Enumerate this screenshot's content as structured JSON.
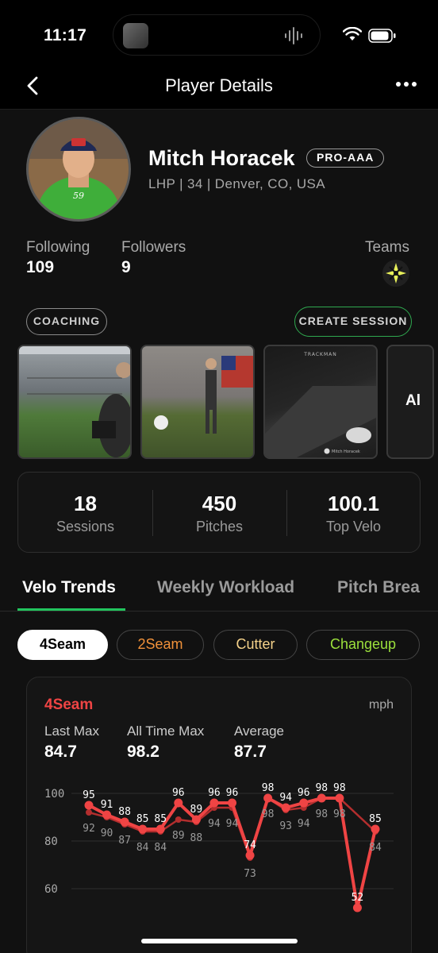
{
  "status_bar": {
    "time": "11:17"
  },
  "nav": {
    "title": "Player Details"
  },
  "profile": {
    "name": "Mitch Horacek",
    "level": "PRO-AAA",
    "meta": "LHP | 34 | Denver, CO, USA"
  },
  "social": {
    "following_label": "Following",
    "following_value": "109",
    "followers_label": "Followers",
    "followers_value": "9",
    "teams_label": "Teams"
  },
  "actions": {
    "coaching": "COACHING",
    "create_session": "CREATE SESSION"
  },
  "media": {
    "third_caption": "TRACKMAN",
    "third_user": "Mitch Horacek",
    "fourth_text": "Al"
  },
  "summary": [
    {
      "value": "18",
      "label": "Sessions"
    },
    {
      "value": "450",
      "label": "Pitches"
    },
    {
      "value": "100.1",
      "label": "Top Velo"
    }
  ],
  "tabs": [
    "Velo Trends",
    "Weekly Workload",
    "Pitch Brea"
  ],
  "pitch_types": [
    {
      "label": "4Seam",
      "color": "#000000"
    },
    {
      "label": "2Seam",
      "color": "#f0913a"
    },
    {
      "label": "Cutter",
      "color": "#f5d28a"
    },
    {
      "label": "Changeup",
      "color": "#9be03c"
    }
  ],
  "card": {
    "title": "4Seam",
    "unit": "mph",
    "metrics": [
      {
        "label": "Last Max",
        "value": "84.7"
      },
      {
        "label": "All Time Max",
        "value": "98.2"
      },
      {
        "label": "Average",
        "value": "87.7"
      }
    ]
  },
  "chart_data": {
    "type": "line",
    "ylim": [
      50,
      100
    ],
    "yticks": [
      "100",
      "80",
      "60"
    ],
    "grid": true,
    "colors": {
      "max": "#ef4444",
      "avg": "#b32e2e"
    },
    "series": [
      {
        "values": [
          95,
          91,
          88,
          85,
          85,
          96,
          89,
          96,
          96,
          74,
          98,
          94,
          96,
          98,
          98,
          52,
          85
        ]
      },
      {
        "values": [
          92,
          90,
          87,
          84,
          84,
          89,
          88,
          94,
          94,
          73,
          98,
          93,
          94,
          98,
          98,
          null,
          84
        ]
      }
    ]
  }
}
